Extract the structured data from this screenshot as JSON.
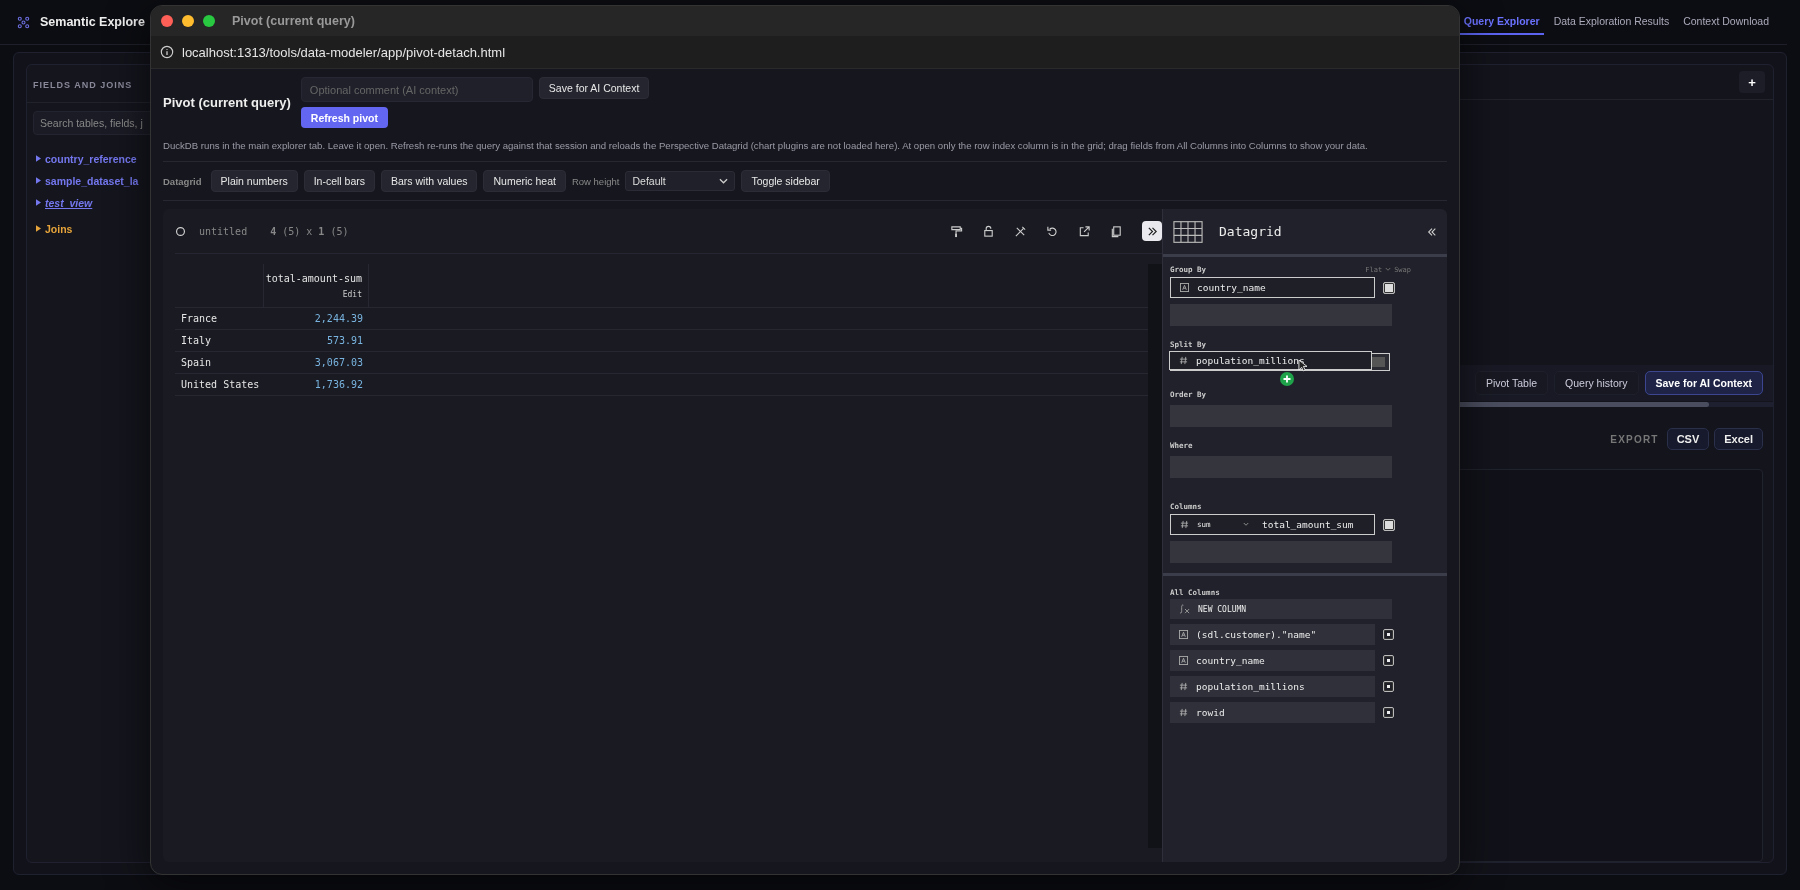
{
  "app": {
    "title": "Semantic Explore",
    "tabs": [
      {
        "label": "Query Explorer",
        "selected": true
      },
      {
        "label": "Data Exploration Results",
        "selected": false
      },
      {
        "label": "Context Download",
        "selected": false
      }
    ],
    "sidebar": {
      "heading": "FIELDS AND JOINS",
      "search": {
        "placeholder": "Search tables, fields, j"
      },
      "items": [
        {
          "label": "country_reference",
          "kind": "table"
        },
        {
          "label": "sample_dataset_la",
          "kind": "table"
        },
        {
          "label": "test_view",
          "kind": "view"
        },
        {
          "label": "Joins",
          "kind": "joins"
        }
      ]
    },
    "add_button": "+",
    "toolbar": [
      {
        "label": "Pivot Table",
        "primary": false
      },
      {
        "label": "Query history",
        "primary": false
      },
      {
        "label": "Save for AI Context",
        "primary": true
      }
    ],
    "export": {
      "label": "EXPORT",
      "buttons": [
        "CSV",
        "Excel"
      ]
    }
  },
  "window": {
    "title": "Pivot (current query)",
    "url": "localhost:1313/tools/data-modeler/app/pivot-detach.html",
    "heading": "Pivot (current query)",
    "comment": {
      "placeholder": "Optional comment (AI context)"
    },
    "save_button": "Save for AI Context",
    "refresh_button": "Refresh pivot",
    "description": "DuckDB runs in the main explorer tab. Leave it open. Refresh re-runs the query against that session and reloads the Perspective Datagrid (chart plugins are not loaded here). At open only the row index column is in the grid; drag fields from All Columns into Columns to show your data.",
    "datagrid_toolbar": {
      "label": "Datagrid",
      "modes": [
        "Plain numbers",
        "In-cell bars",
        "Bars with values",
        "Numeric heat"
      ],
      "row_height_label": "Row height",
      "row_height": "Default",
      "toggle": "Toggle sidebar"
    },
    "viewer": {
      "name": "untitled",
      "dims": "**4** (5) x **1** (5)",
      "grid": {
        "column": "total-amount-sum",
        "edit": "Edit",
        "rows": [
          {
            "label": "France",
            "value": "2,244.39"
          },
          {
            "label": "Italy",
            "value": "573.91"
          },
          {
            "label": "Spain",
            "value": "3,067.03"
          },
          {
            "label": "United States",
            "value": "1,736.92"
          }
        ]
      },
      "settings": {
        "title": "Datagrid",
        "group_by": {
          "label": "Group By",
          "mode": "Flat",
          "swap": "Swap",
          "items": [
            {
              "name": "country_name",
              "kind": "string"
            }
          ]
        },
        "split_by": {
          "label": "Split By",
          "dragging": {
            "name": "population_millions",
            "kind": "number"
          }
        },
        "order_by": {
          "label": "Order By"
        },
        "where": {
          "label": "Where"
        },
        "columns": {
          "label": "Columns",
          "items": [
            {
              "aggregate": "sum",
              "name": "total_amount_sum",
              "kind": "number"
            }
          ]
        },
        "all_columns": {
          "label": "All Columns",
          "new_column": "NEW COLUMN",
          "items": [
            {
              "name": "(sdl.customer).\"name\"",
              "kind": "string"
            },
            {
              "name": "country_name",
              "kind": "string"
            },
            {
              "name": "population_millions",
              "kind": "number"
            },
            {
              "name": "rowid",
              "kind": "number"
            }
          ]
        }
      }
    }
  }
}
